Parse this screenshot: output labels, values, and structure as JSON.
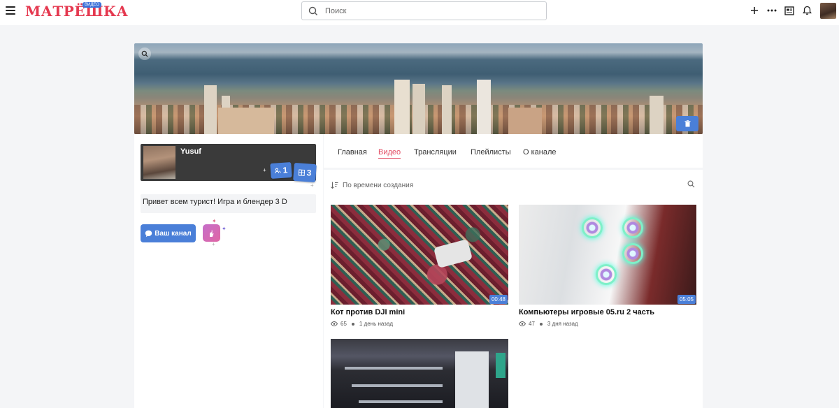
{
  "header": {
    "logo_text": "МАТРЁШКА",
    "logo_badge": "ВИДЕО",
    "search_placeholder": "Поиск",
    "icons": [
      "menu-icon",
      "search-icon",
      "plus-icon",
      "more-icon",
      "news-icon",
      "bell-icon",
      "avatar"
    ]
  },
  "profile": {
    "name": "Yusuf",
    "subscribers_count": "1",
    "videos_count": "3",
    "bio": "Привет всем турист! Игра и блендер 3 D",
    "channel_button": "Ваш канал"
  },
  "tabs": [
    {
      "label": "Главная",
      "active": false
    },
    {
      "label": "Видео",
      "active": true
    },
    {
      "label": "Трансляции",
      "active": false
    },
    {
      "label": "Плейлисты",
      "active": false
    },
    {
      "label": "О канале",
      "active": false
    }
  ],
  "sort": {
    "label": "По времени создания"
  },
  "videos": [
    {
      "title": "Кот против DJI mini",
      "duration": "00:48",
      "views": "65",
      "age": "1 день назад"
    },
    {
      "title": "Компьютеры игровые 05.ru 2 часть",
      "duration": "05:05",
      "views": "47",
      "age": "3 дня назад"
    },
    {
      "title": "",
      "duration": "",
      "views": "",
      "age": ""
    }
  ],
  "colors": {
    "accent": "#4a7fd8",
    "active_tab": "#e24b62",
    "logo": "#e53950"
  }
}
